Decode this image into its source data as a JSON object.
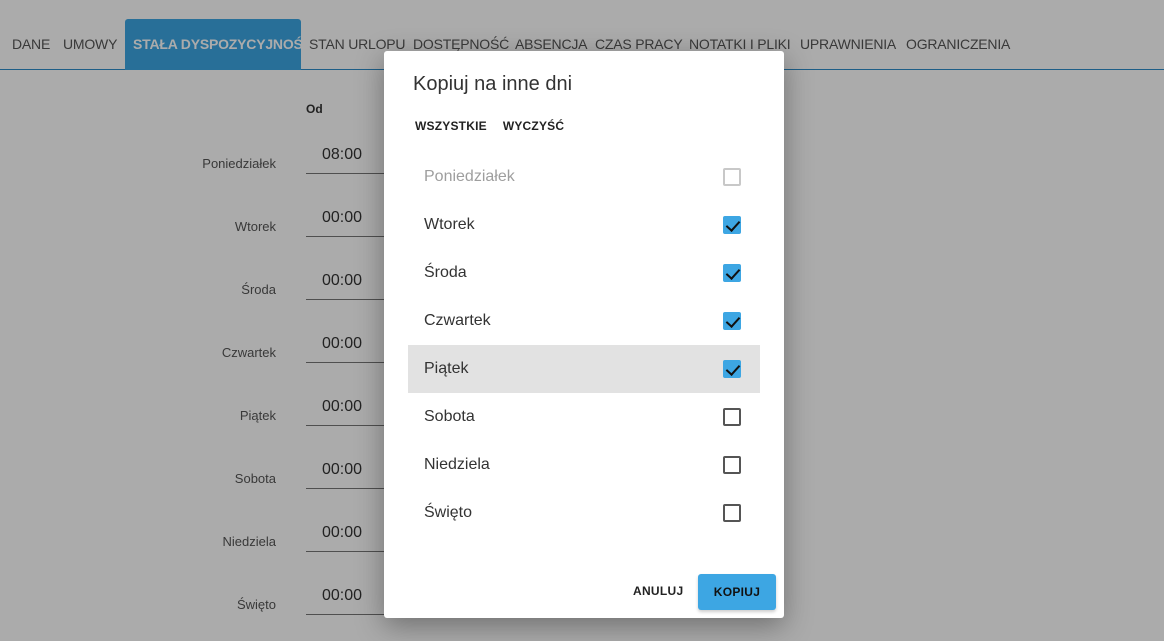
{
  "tabs": [
    {
      "label": "DANE"
    },
    {
      "label": "UMOWY"
    },
    {
      "label": "STAŁA DYSPOZYCYJNOŚĆ",
      "active": true
    },
    {
      "label": "STAN URLOPU"
    },
    {
      "label": "DOSTĘPNOŚĆ"
    },
    {
      "label": "ABSENCJA"
    },
    {
      "label": "CZAS PRACY"
    },
    {
      "label": "NOTATKI I PLIKI"
    },
    {
      "label": "UPRAWNIENIA"
    },
    {
      "label": "OGRANICZENIA"
    }
  ],
  "schedule": {
    "from_header": "Od",
    "rows": [
      {
        "day": "Poniedziałek",
        "from": "08:00"
      },
      {
        "day": "Wtorek",
        "from": "00:00"
      },
      {
        "day": "Środa",
        "from": "00:00"
      },
      {
        "day": "Czwartek",
        "from": "00:00"
      },
      {
        "day": "Piątek",
        "from": "00:00"
      },
      {
        "day": "Sobota",
        "from": "00:00"
      },
      {
        "day": "Niedziela",
        "from": "00:00"
      },
      {
        "day": "Święto",
        "from": "00:00"
      }
    ]
  },
  "dialog": {
    "title": "Kopiuj na inne dni",
    "select_all_label": "WSZYSTKIE",
    "clear_label": "WYCZYŚĆ",
    "days": [
      {
        "name": "Poniedziałek",
        "checked": false,
        "disabled": true
      },
      {
        "name": "Wtorek",
        "checked": true
      },
      {
        "name": "Środa",
        "checked": true
      },
      {
        "name": "Czwartek",
        "checked": true
      },
      {
        "name": "Piątek",
        "checked": true,
        "highlighted": true
      },
      {
        "name": "Sobota",
        "checked": false
      },
      {
        "name": "Niedziela",
        "checked": false
      },
      {
        "name": "Święto",
        "checked": false
      }
    ],
    "cancel_label": "ANULUJ",
    "copy_label": "KOPIUJ"
  },
  "colors": {
    "accent": "#3da6e3",
    "overlay": "rgba(0,0,0,0.33)",
    "highlight": "#e2e2e2"
  }
}
